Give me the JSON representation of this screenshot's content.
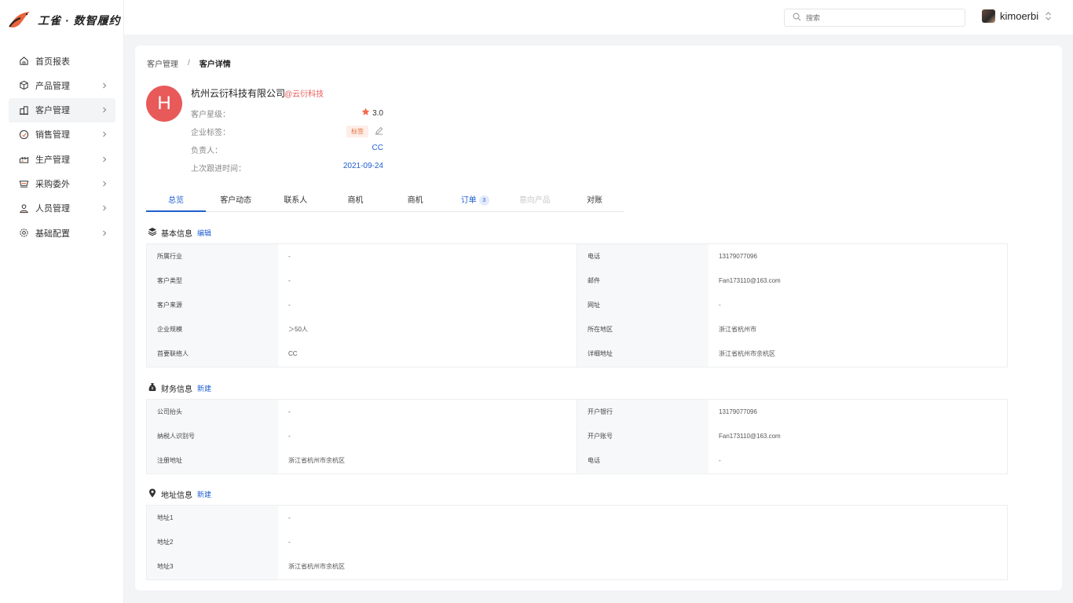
{
  "brand": {
    "name": "工雀 · 数智履约"
  },
  "sidebar": {
    "items": [
      {
        "label": "首页报表",
        "icon": "home-icon",
        "chevron": false
      },
      {
        "label": "产品管理",
        "icon": "box-icon",
        "chevron": true
      },
      {
        "label": "客户管理",
        "icon": "building-icon",
        "chevron": true,
        "active": true
      },
      {
        "label": "销售管理",
        "icon": "sales-icon",
        "chevron": true
      },
      {
        "label": "生产管理",
        "icon": "factory-icon",
        "chevron": true
      },
      {
        "label": "采购委外",
        "icon": "purchase-icon",
        "chevron": true
      },
      {
        "label": "人员管理",
        "icon": "user-icon",
        "chevron": true
      },
      {
        "label": "基础配置",
        "icon": "settings-icon",
        "chevron": true
      }
    ]
  },
  "header": {
    "search_placeholder": "搜索",
    "username": "kimoerbi"
  },
  "breadcrumb": {
    "parent": "客户管理",
    "separator": "/",
    "current": "客户详情"
  },
  "company": {
    "avatar_letter": "H",
    "name": "杭州云衍科技有限公司",
    "alias": "@云衍科技",
    "rows": {
      "star_label": "客户星级：",
      "star_value": "3.0",
      "tag_label": "企业标签：",
      "tag_value": "标签",
      "owner_label": "负责人：",
      "owner_value": "CC",
      "follow_label": "上次跟进时间：",
      "follow_value": "2021-09-24"
    }
  },
  "tabs": [
    {
      "label": "总览",
      "state": "active"
    },
    {
      "label": "客户动态",
      "state": "normal"
    },
    {
      "label": "联系人",
      "state": "normal"
    },
    {
      "label": "商机",
      "state": "normal"
    },
    {
      "label": "商机",
      "state": "normal"
    },
    {
      "label": "订单",
      "state": "blue",
      "badge": "3"
    },
    {
      "label": "意向产品",
      "state": "disabled"
    },
    {
      "label": "对账",
      "state": "normal"
    }
  ],
  "basic": {
    "title": "基本信息",
    "action": "编辑",
    "rows": [
      [
        "所属行业",
        "-",
        "电话",
        "13179077096"
      ],
      [
        "客户类型",
        "-",
        "邮件",
        "Fan173110@163.com"
      ],
      [
        "客户来源",
        "-",
        "网址",
        "-"
      ],
      [
        "企业规模",
        "＞50人",
        "所在地区",
        "浙江省杭州市"
      ],
      [
        "首要联络人",
        "CC",
        "详细地址",
        "浙江省杭州市余杭区"
      ]
    ]
  },
  "finance": {
    "title": "财务信息",
    "action": "新建",
    "rows": [
      [
        "公司抬头",
        "-",
        "开户银行",
        "13179077096"
      ],
      [
        "纳税人识别号",
        "-",
        "开户账号",
        "Fan173110@163.com"
      ],
      [
        "注册地址",
        "浙江省杭州市余杭区",
        "电话",
        "-"
      ]
    ]
  },
  "address": {
    "title": "地址信息",
    "action": "新建",
    "rows": [
      [
        "地址1",
        "-"
      ],
      [
        "地址2",
        "-"
      ],
      [
        "地址3",
        "浙江省杭州市余杭区"
      ]
    ]
  },
  "colors": {
    "accent": "#1f5fd0",
    "brand_red": "#e85a5a",
    "tag_orange": "#e86f3f"
  }
}
